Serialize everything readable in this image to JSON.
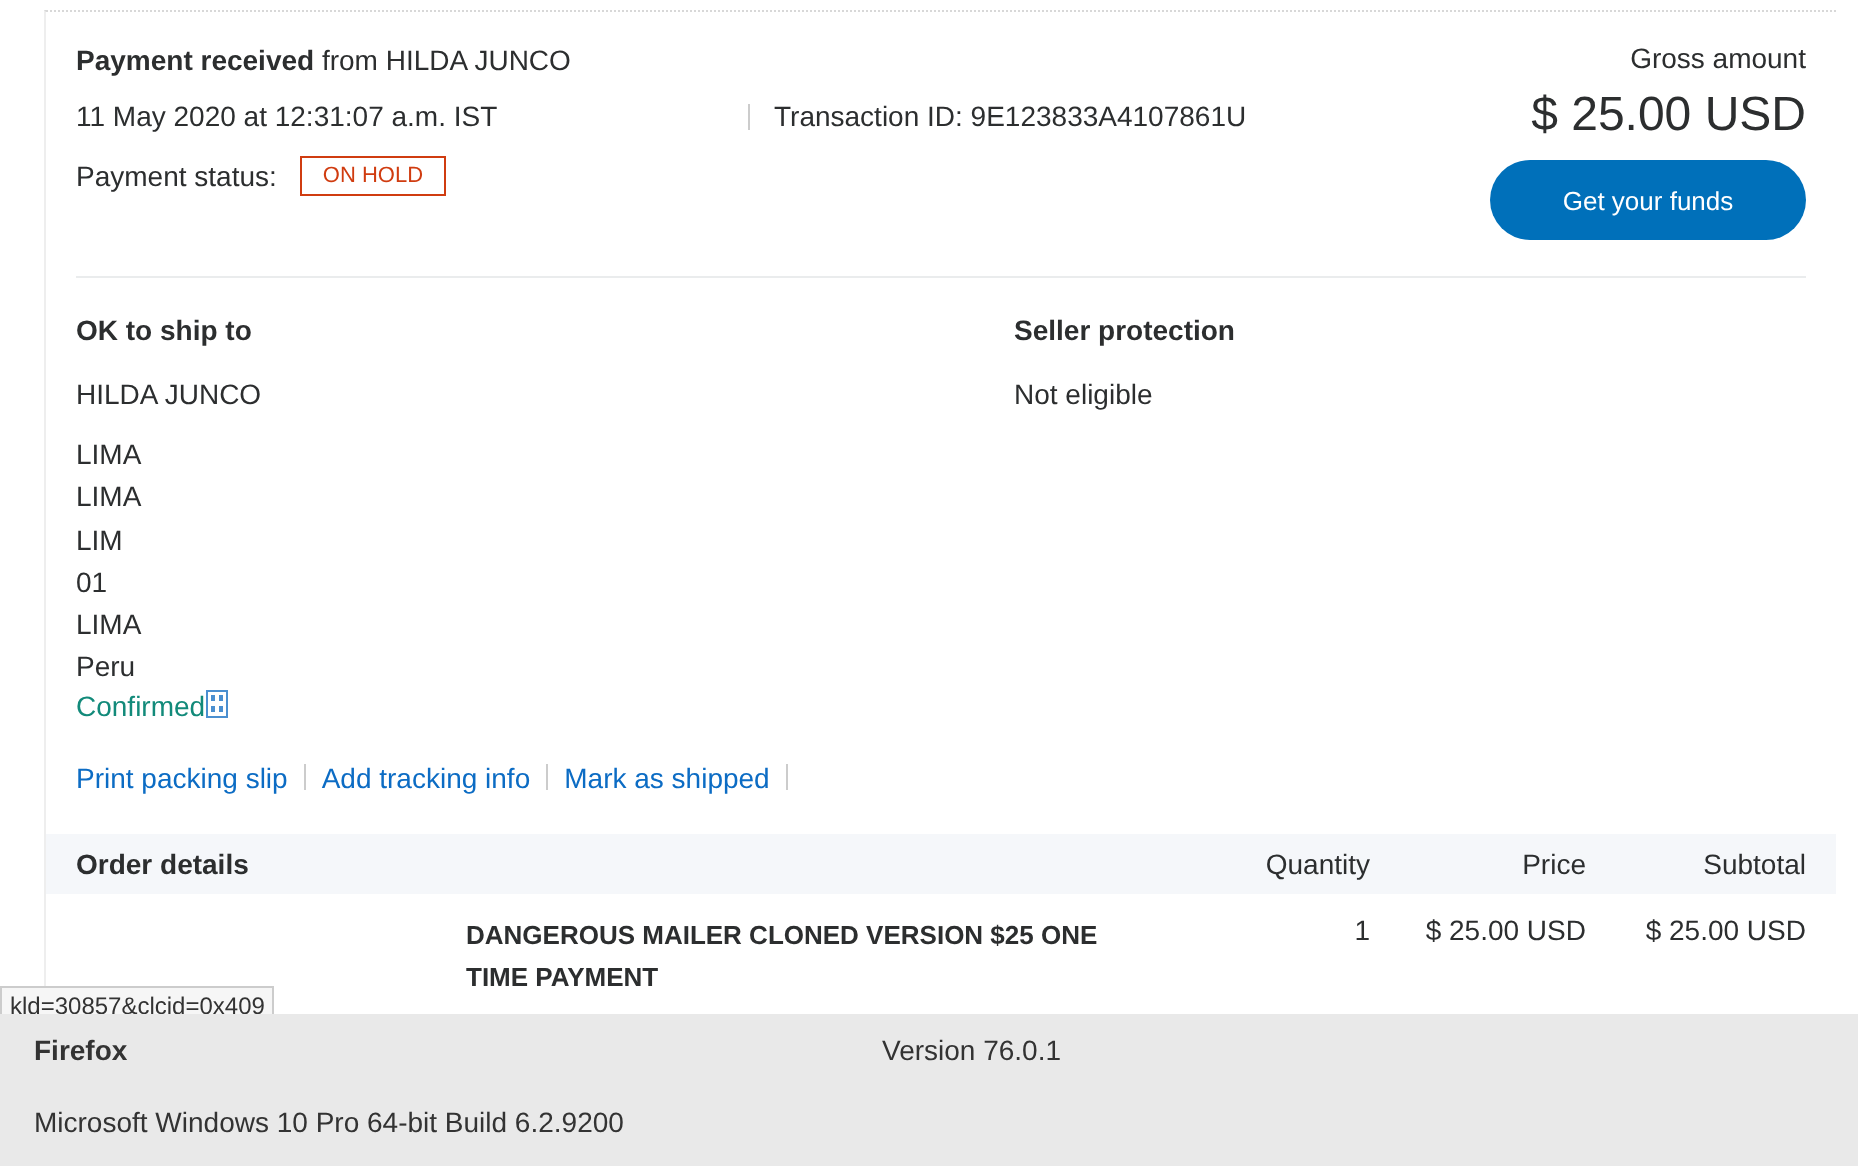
{
  "summary": {
    "heading": "**Payment received** from HILDA JUNCO",
    "date": "11 May 2020 at 12:31:07 a.m. IST",
    "transaction_id": "Transaction ID: 9E123833A4107861U",
    "status_label": "Payment status:",
    "status_badge": "ON HOLD",
    "gross_label": "Gross amount",
    "gross_amount": "$ 25.00 USD",
    "button": "Get your funds"
  },
  "shipping": {
    "title": "OK to ship to",
    "name": "HILDA JUNCO",
    "address_lines": [
      "LIMA",
      "LIMA",
      "LIM",
      "01",
      "LIMA",
      "Peru"
    ],
    "confirmed": "Confirmed"
  },
  "seller_protection": {
    "title": "Seller protection",
    "value": "Not eligible"
  },
  "actions": [
    "Print packing slip",
    "Add tracking info",
    "Mark as shipped"
  ],
  "order": {
    "columns": [
      "Order details",
      "Quantity",
      "Price",
      "Subtotal"
    ],
    "rows": [
      {
        "item": "DANGEROUS MAILER CLONED VERSION $25 ONE TIME PAYMENT",
        "quantity": "1",
        "price": "$ 25.00 USD",
        "subtotal": "$ 25.00 USD"
      }
    ]
  },
  "status_url": "kld=30857&clcid=0x409",
  "footer": {
    "browser": "Firefox",
    "version": "Version 76.0.1",
    "os": "Microsoft Windows 10 Pro 64-bit Build 6.2.9200"
  }
}
